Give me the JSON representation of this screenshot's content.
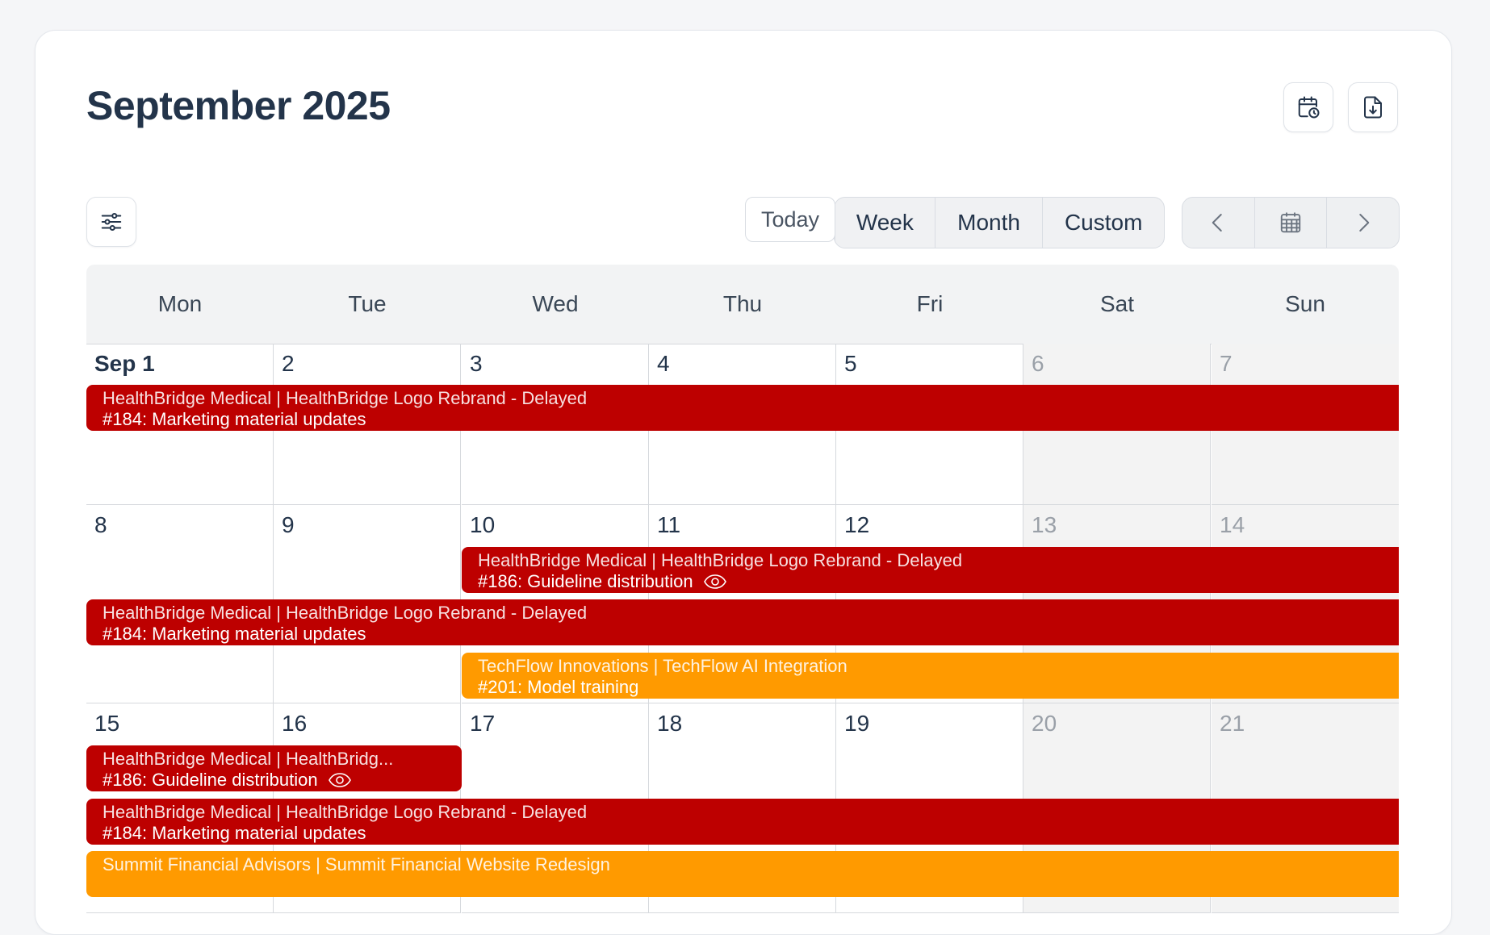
{
  "header": {
    "title": "September 2025"
  },
  "colors": {
    "delayed": "#bd0000",
    "active": "#ff9a00"
  },
  "toolbar": {
    "schedule_icon": "calendar-clock-icon",
    "export_icon": "file-download-icon",
    "filter_icon": "sliders-icon",
    "today_label": "Today",
    "views": [
      "Week",
      "Month",
      "Custom"
    ],
    "nav_icons": [
      "chevron-left-icon",
      "calendar-grid-icon",
      "chevron-right-icon"
    ]
  },
  "calendar": {
    "weekdays": [
      "Mon",
      "Tue",
      "Wed",
      "Thu",
      "Fri",
      "Sat",
      "Sun"
    ],
    "weeks": [
      [
        "Sep 1",
        "2",
        "3",
        "4",
        "5",
        "6",
        "7"
      ],
      [
        "8",
        "9",
        "10",
        "11",
        "12",
        "13",
        "14"
      ],
      [
        "15",
        "16",
        "17",
        "18",
        "19",
        "20",
        "21"
      ]
    ],
    "events": [
      {
        "title": "HealthBridge Medical | HealthBridge Logo Rebrand - Delayed",
        "sub": "#184: Marketing material updates",
        "status": "delayed",
        "watched": false
      },
      {
        "title": "HealthBridge Medical | HealthBridge Logo Rebrand - Delayed",
        "sub": "#186: Guideline distribution",
        "status": "delayed",
        "watched": true
      },
      {
        "title": "HealthBridge Medical | HealthBridge Logo Rebrand - Delayed",
        "sub": "#184: Marketing material updates",
        "status": "delayed",
        "watched": false
      },
      {
        "title": "TechFlow Innovations | TechFlow AI Integration",
        "sub": "#201: Model training",
        "status": "active",
        "watched": false
      },
      {
        "title": "HealthBridge Medical | HealthBridg...",
        "sub": "#186: Guideline distribution",
        "status": "delayed",
        "watched": true
      },
      {
        "title": "HealthBridge Medical | HealthBridge Logo Rebrand - Delayed",
        "sub": "#184: Marketing material updates",
        "status": "delayed",
        "watched": false
      },
      {
        "title": "Summit Financial Advisors | Summit Financial Website Redesign",
        "sub": "",
        "status": "active",
        "watched": false
      }
    ]
  }
}
